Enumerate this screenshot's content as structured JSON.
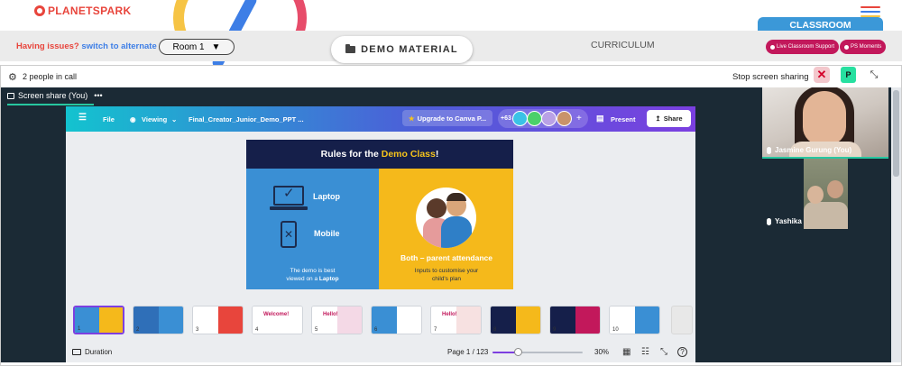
{
  "colors": {
    "brand_red": "#e8453c",
    "link_blue": "#3d7ee6",
    "classroom_blue": "#3b98d8",
    "support_pink": "#c2185b",
    "meet_dark": "#1b2a35",
    "accent_green": "#27c7a0",
    "canva_purple": "#7d3fe0"
  },
  "header": {
    "logo_text": "PLANETSPARK",
    "issues_prefix": "Having issues?",
    "issues_link": "switch to alternate room",
    "room_selector": "Room 1",
    "demo_material": "DEMO MATERIAL",
    "curriculum": "CURRICULUM",
    "classroom_tab": "CLASSROOM",
    "live_support": "Live Classroom Support",
    "ps_moments": "PS Moments"
  },
  "call_bar": {
    "people_count": "2 people in call",
    "stop_sharing": "Stop screen sharing",
    "p_label": "P"
  },
  "share": {
    "title": "Screen share (You)",
    "more": "•••"
  },
  "canva": {
    "file": "File",
    "viewing": "Viewing",
    "doc_title": "Final_Creator_Junior_Demo_PPT ...",
    "upgrade": "Upgrade to Canva P...",
    "collab_count": "+63",
    "present": "Present",
    "share": "Share"
  },
  "slide": {
    "title_prefix": "Rules for the",
    "title_accent": "Demo Class",
    "title_suffix": "!",
    "laptop": "Laptop",
    "mobile": "Mobile",
    "demo_note_1": "The demo is best",
    "demo_note_2": "viewed on a",
    "demo_note_bold": "Laptop",
    "parent_title": "Both – parent attendance",
    "parent_note_1": "Inputs to customise your",
    "parent_note_2": "child's plan"
  },
  "thumbnails": [
    {
      "num": "1",
      "left": "#3a8fd4",
      "right": "#f5b91b"
    },
    {
      "num": "2",
      "left": "#2f6fb8",
      "right": "#3a8fd4"
    },
    {
      "num": "3",
      "left": "#ffffff",
      "right": "#e8453c"
    },
    {
      "num": "4",
      "left": "#ffffff",
      "right": "#ffffff"
    },
    {
      "num": "5",
      "left": "#ffffff",
      "right": "#f4d9e6"
    },
    {
      "num": "6",
      "left": "#3a8fd4",
      "right": "#ffffff"
    },
    {
      "num": "7",
      "left": "#ffffff",
      "right": "#f7e1e1"
    },
    {
      "num": "8",
      "left": "#151f4a",
      "right": "#f5b91b"
    },
    {
      "num": "9",
      "left": "#151f4a",
      "right": "#c2185b"
    },
    {
      "num": "10",
      "left": "#ffffff",
      "right": "#3a8fd4"
    }
  ],
  "thumb_texts": {
    "t4": "Welcome!",
    "t5": "Hello!",
    "t7": "Hello!"
  },
  "bottom": {
    "duration": "Duration",
    "page": "Page 1 / 123",
    "zoom": "30%",
    "zoom_level_percent": 30
  },
  "participants": [
    {
      "name": "Jasmine Gurung (You)"
    },
    {
      "name": "Yashika"
    }
  ]
}
